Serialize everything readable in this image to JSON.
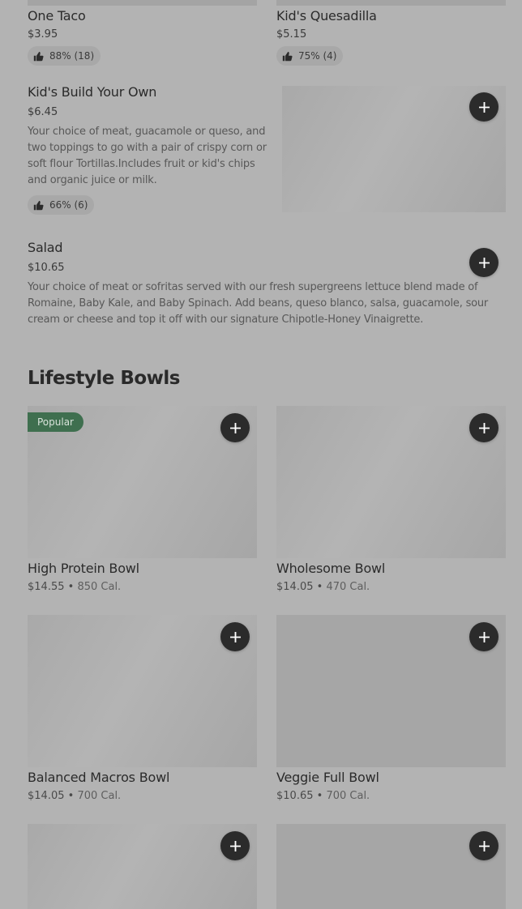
{
  "top_items": [
    {
      "name": "One Taco",
      "price": "$3.95",
      "rating": "88% (18)"
    },
    {
      "name": "Kid's Quesadilla",
      "price": "$5.15",
      "rating": "75% (4)"
    }
  ],
  "kids_build": {
    "name": "Kid's Build Your Own",
    "price": "$6.45",
    "description": "Your choice of meat, guacamole or queso, and two toppings to go with a pair of crispy corn or soft flour Tortillas.Includes fruit or kid's chips and organic juice or milk.",
    "rating": "66% (6)"
  },
  "salad": {
    "name": "Salad",
    "price": "$10.65",
    "description": "Your choice of meat or sofritas served with our fresh supergreens lettuce blend made of Romaine, Baby Kale, and Baby Spinach. Add beans, queso blanco, salsa, guacamole, sour cream or cheese and top it off with our signature Chipotle-Honey Vinaigrette."
  },
  "section": {
    "title": "Lifestyle Bowls"
  },
  "bowls": [
    {
      "name": "High Protein Bowl",
      "price": "$14.55",
      "separator": "•",
      "calories": "850 Cal.",
      "badge": "Popular"
    },
    {
      "name": "Wholesome Bowl",
      "price": "$14.05",
      "separator": "•",
      "calories": "470 Cal."
    },
    {
      "name": "Balanced Macros Bowl",
      "price": "$14.05",
      "separator": "•",
      "calories": "700 Cal."
    },
    {
      "name": "Veggie Full Bowl",
      "price": "$10.65",
      "separator": "•",
      "calories": "700 Cal."
    }
  ],
  "icons": {
    "rating": "thumbs-up-icon",
    "add": "plus-icon"
  },
  "colors": {
    "background": "#b3b3b3",
    "add_button": "#2b2b2b",
    "badge": "#3f6f4f"
  }
}
